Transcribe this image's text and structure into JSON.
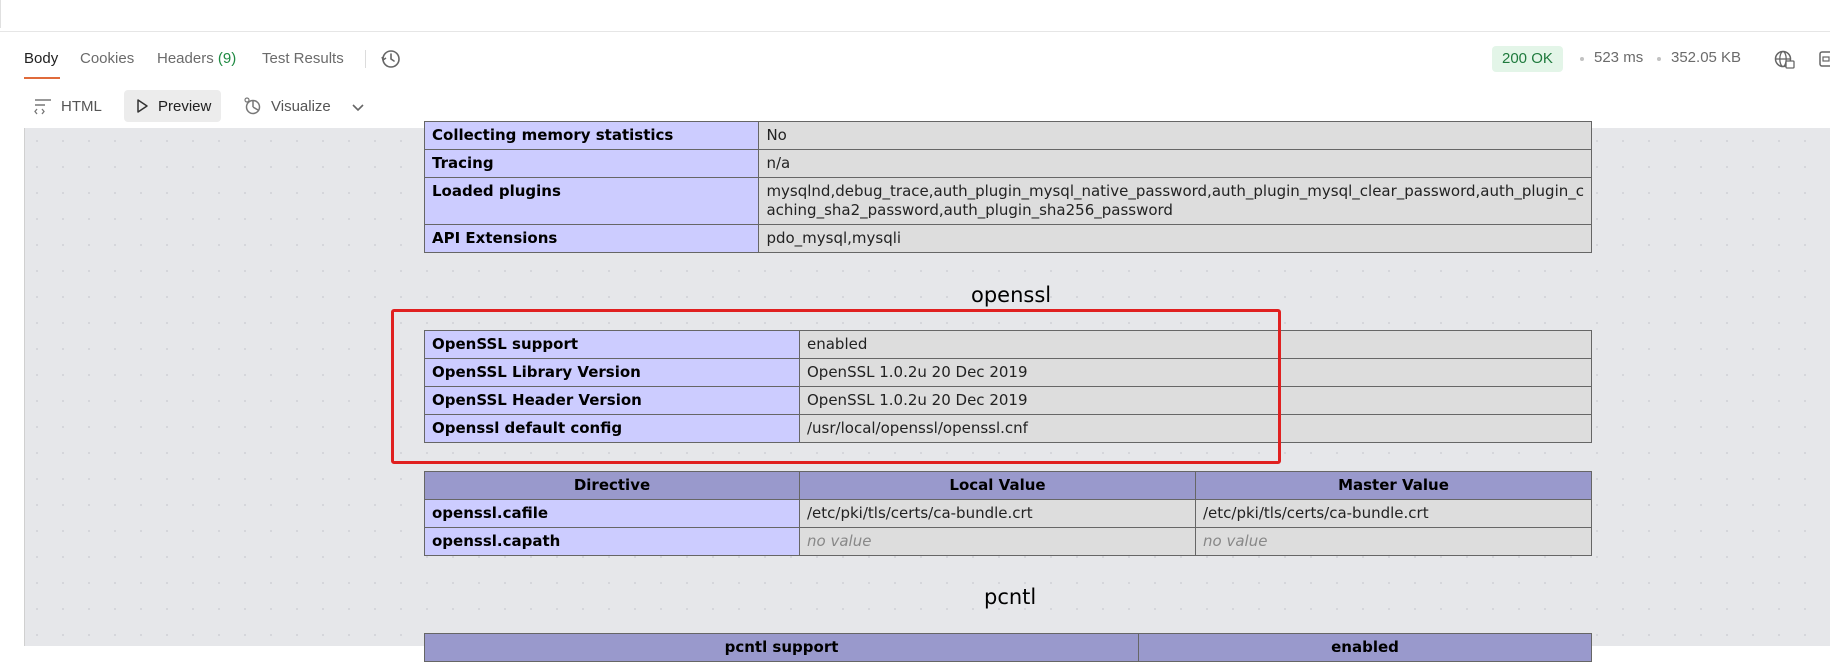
{
  "tabs": [
    {
      "label": "Body"
    },
    {
      "label": "Cookies"
    },
    {
      "label": "Headers",
      "count": "(9)"
    },
    {
      "label": "Test Results"
    }
  ],
  "status": {
    "code": "200 OK",
    "time": "523 ms",
    "size": "352.05 KB",
    "badge_color": "#e3f5e8",
    "text_color": "#1f7a3d"
  },
  "view": {
    "html": "HTML",
    "preview": "Preview",
    "visualize": "Visualize"
  },
  "mysql_rows": [
    {
      "k": "Collecting memory statistics",
      "v": "No"
    },
    {
      "k": "Tracing",
      "v": "n/a"
    },
    {
      "k": "Loaded plugins",
      "v1": "mysqlnd,debug_trace,auth_plugin_mysql_native_password,auth_plugin_mysql_clear_password,auth_plugin_c",
      "v2": "aching_sha2_password,auth_plugin_sha256_password"
    },
    {
      "k": "API Extensions",
      "v": "pdo_mysql,mysqli"
    }
  ],
  "openssl": {
    "title": "openssl",
    "rows": [
      {
        "k": "OpenSSL support",
        "v": "enabled"
      },
      {
        "k": "OpenSSL Library Version",
        "v": "OpenSSL 1.0.2u 20 Dec 2019"
      },
      {
        "k": "OpenSSL Header Version",
        "v": "OpenSSL 1.0.2u 20 Dec 2019"
      },
      {
        "k": "Openssl default config",
        "v": "/usr/local/openssl/openssl.cnf"
      }
    ],
    "directive_headers": [
      "Directive",
      "Local Value",
      "Master Value"
    ],
    "directives": [
      {
        "name": "openssl.cafile",
        "local": "/etc/pki/tls/certs/ca-bundle.crt",
        "master": "/etc/pki/tls/certs/ca-bundle.crt"
      },
      {
        "name": "openssl.capath",
        "local": "no value",
        "master": "no value"
      }
    ]
  },
  "pcntl": {
    "title": "pcntl",
    "header_left": "pcntl support",
    "header_right": "enabled"
  }
}
